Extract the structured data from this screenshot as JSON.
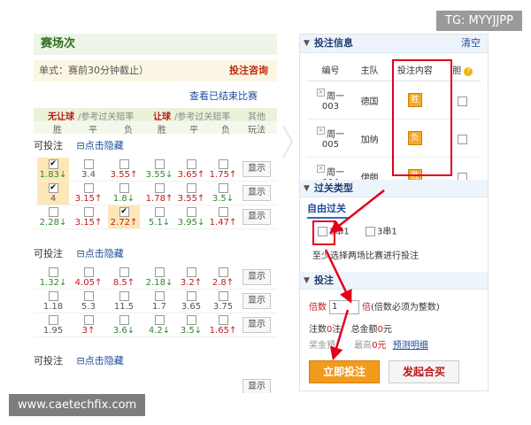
{
  "watermark_top": "TG: MYYJJPP",
  "watermark_bottom": "www.caetechfix.com",
  "left": {
    "title": "赛场次",
    "info": "单式：赛前30分钟截止）",
    "consult": "投注咨询",
    "view_ended": "查看已结束比赛",
    "head_noconcede": "无让球",
    "head_noconcede_sub": "/参考过关赔率",
    "head_concede": "让球",
    "head_concede_sub": "/参考过关赔率",
    "head_other": "其他",
    "head_cols": [
      "胜",
      "平",
      "负",
      "胜",
      "平",
      "负",
      "玩法"
    ],
    "sections": [
      {
        "label": "可投注",
        "toggle": "点击隐藏",
        "rows": [
          {
            "odds": [
              "1.83↓",
              "3.4",
              "3.55↑",
              "3.55↓",
              "3.65↑",
              "1.75↑"
            ],
            "checked": [
              true,
              false,
              false,
              false,
              false,
              false
            ],
            "show": "显示"
          },
          {
            "odds": [
              "4",
              "3.15↑",
              "1.8↓",
              "1.78↑",
              "3.55↑",
              "3.5↓"
            ],
            "checked": [
              true,
              false,
              false,
              false,
              false,
              false
            ],
            "show": "显示"
          },
          {
            "odds": [
              "2.28↓",
              "3.15↑",
              "2.72↑",
              "5.1↓",
              "3.95↓",
              "1.47↑"
            ],
            "checked": [
              false,
              false,
              true,
              false,
              false,
              false
            ],
            "show": "显示"
          }
        ]
      },
      {
        "label": "可投注",
        "toggle": "点击隐藏",
        "rows": [
          {
            "odds": [
              "1.32↓",
              "4.05↑",
              "8.5↑",
              "2.18↓",
              "3.2↑",
              "2.8↑"
            ],
            "checked": [
              false,
              false,
              false,
              false,
              false,
              false
            ],
            "show": "显示"
          },
          {
            "odds": [
              "1.18",
              "5.3",
              "11.5",
              "1.7",
              "3.65",
              "3.75"
            ],
            "checked": [
              false,
              false,
              false,
              false,
              false,
              false
            ],
            "show": "显示"
          },
          {
            "odds": [
              "1.95",
              "3↑",
              "3.6↓",
              "4.2↓",
              "3.5↓",
              "1.65↑"
            ],
            "checked": [
              false,
              false,
              false,
              false,
              false,
              false
            ],
            "show": "显示"
          }
        ]
      },
      {
        "label": "可投注",
        "toggle": "点击隐藏",
        "rows": []
      }
    ]
  },
  "right": {
    "betinfo_title": "投注信息",
    "clear": "清空",
    "cols": [
      "编号",
      "主队",
      "投注内容",
      "胆"
    ],
    "bets": [
      {
        "id_a": "周一",
        "id_b": "003",
        "team": "德国",
        "pick": "胜"
      },
      {
        "id_a": "周一",
        "id_b": "005",
        "team": "加纳",
        "pick": "负"
      },
      {
        "id_a": "周一",
        "id_b": "004",
        "team": "伊朗",
        "pick": "胜"
      }
    ],
    "pass_title": "过关类型",
    "pass_tab": "自由过关",
    "opt1": "2串1",
    "opt2": "3串1",
    "pass_note": "至少选择两场比赛进行投注",
    "bet_title": "投注",
    "multiple_label": "倍数",
    "multiple_value": "1",
    "multiple_unit": "倍",
    "multiple_note": "(倍数必须为整数)",
    "count_label": "注数",
    "count_value": "0",
    "count_unit": "注",
    "total_label": "总金额",
    "total_value": "0",
    "total_unit": "元",
    "prize_label": "奖金预",
    "max_label": "最高",
    "max_value": "0元",
    "predict": "预测明细",
    "btn_go": "立即投注",
    "btn_hm": "发起合买"
  },
  "colors": {
    "highlight": "#e3001b",
    "accent": "#f19a1c",
    "brand_green": "#2e6e1e"
  }
}
